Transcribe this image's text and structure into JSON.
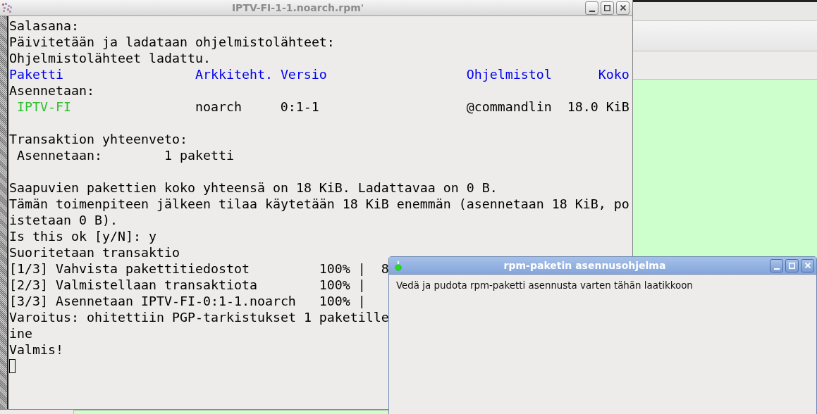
{
  "terminal": {
    "title": "IPTV-FI-1-1.noarch.rpm'",
    "lines": [
      {
        "kind": "plain",
        "text": "Salasana:"
      },
      {
        "kind": "plain",
        "text": "Päivitetään ja ladataan ohjelmistolähteet:"
      },
      {
        "kind": "plain",
        "text": "Ohjelmistolähteet ladattu."
      },
      {
        "kind": "header",
        "cells": [
          "Paketti",
          "Arkkiteht.",
          "Versio",
          "Ohjelmistol",
          "Koko"
        ]
      },
      {
        "kind": "plain",
        "text": "Asennetaan:"
      },
      {
        "kind": "package",
        "cells": [
          "IPTV-FI",
          "noarch",
          "0:1-1",
          "@commandlin",
          "18.0 KiB"
        ]
      },
      {
        "kind": "blank"
      },
      {
        "kind": "plain",
        "text": "Transaktion yhteenveto:"
      },
      {
        "kind": "summary",
        "cells": [
          "Asennetaan:",
          "1 paketti"
        ]
      },
      {
        "kind": "blank"
      },
      {
        "kind": "plain",
        "text": "Saapuvien pakettien koko yhteensä on 18 KiB. Ladattavaa on 0 B."
      },
      {
        "kind": "plain",
        "text": "Tämän toimenpiteen jälkeen tilaa käytetään 18 KiB enemmän (asennetaan 18 KiB, po"
      },
      {
        "kind": "plain",
        "text": "istetaan 0 B)."
      },
      {
        "kind": "plain",
        "text": "Is this ok [y/N]: y"
      },
      {
        "kind": "plain",
        "text": "Suoritetaan transaktio"
      },
      {
        "kind": "progress",
        "cells": [
          "[1/3]",
          "Vahvista pakettitiedostot",
          "100%",
          "|",
          "8"
        ]
      },
      {
        "kind": "progress",
        "cells": [
          "[2/3]",
          "Valmistellaan transaktiota",
          "100%",
          "|"
        ]
      },
      {
        "kind": "progress",
        "cells": [
          "[3/3]",
          "Asennetaan IPTV-FI-0:1-1.noarch",
          "100%",
          "|"
        ]
      },
      {
        "kind": "plain",
        "text": "Varoitus: ohitettiin PGP-tarkistukset 1 paketille"
      },
      {
        "kind": "plain",
        "text": "ine"
      },
      {
        "kind": "plain",
        "text": "Valmis!"
      },
      {
        "kind": "cursor"
      }
    ]
  },
  "installer": {
    "title": "rpm-paketin asennusohjelma",
    "message": "Vedä ja pudota rpm-paketti asennusta varten tähän laatikkoon"
  }
}
